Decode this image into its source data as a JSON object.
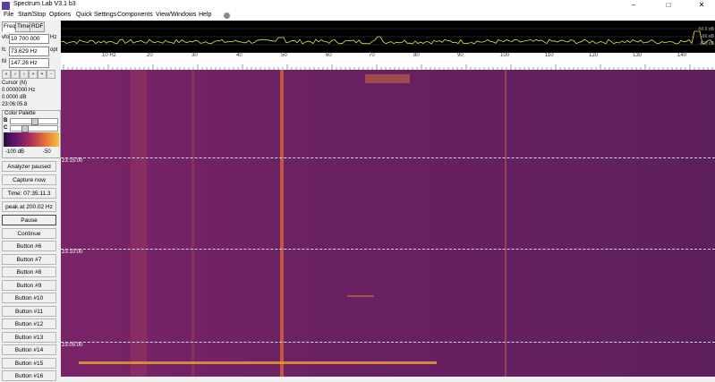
{
  "window": {
    "title": "Spectrum Lab V3.1 b3",
    "minimize": "–",
    "maximize": "□",
    "close": "✕"
  },
  "menu": [
    "File",
    "Start/Stop",
    "Options",
    "Quick Settings",
    "Components",
    "View/Windows",
    "Help"
  ],
  "left": {
    "tabs": [
      "Freq",
      "Time",
      "RDF"
    ],
    "vfo_label": "vfo",
    "vfo_value": "10 700 000",
    "vfo_unit": "Hz",
    "fc_label": "fc",
    "fc_value": "73.629 Hz",
    "fc_unit": "opt",
    "fd_label": "fd",
    "fd_value": "147.26 Hz",
    "nav": [
      "«",
      "‹",
      "›",
      "»",
      "+",
      "-"
    ],
    "cursor": {
      "title": "Cursor (N)",
      "freq": "0.0000000 Hz",
      "db": "0.0000 dB",
      "time": "23:06:05.8"
    },
    "palette": {
      "title": "Color Palette",
      "b_label": "B",
      "c_label": "C",
      "b_level": 0.5,
      "c_level": 0.25,
      "min_label": "-100 dB",
      "max_label": "-50"
    },
    "buttons": [
      "Analyzer paused",
      "Capture now",
      "Time: 07:35:11.3",
      "peak at 200.02 Hz",
      "Pause",
      "Continue",
      "Button #6",
      "Button #7",
      "Button #8",
      "Button #9",
      "Button #10",
      "Button #11",
      "Button #12",
      "Button #13",
      "Button #14",
      "Button #15",
      "Button #16"
    ]
  },
  "spectrum": {
    "db_labels": [
      "-50.0 dB",
      "-80 dB",
      "-100 dB"
    ],
    "trace_color": "#e8e84a",
    "axis_labels": [
      "10 Hz",
      "20",
      "30",
      "40",
      "50",
      "60",
      "70",
      "80",
      "90",
      "100",
      "110",
      "120",
      "130",
      "140"
    ]
  },
  "waterfall": {
    "times": [
      "23:15:00",
      "23:10:00",
      "23:05:00"
    ],
    "background": "#6a2162",
    "highlight": "#f0a030"
  }
}
